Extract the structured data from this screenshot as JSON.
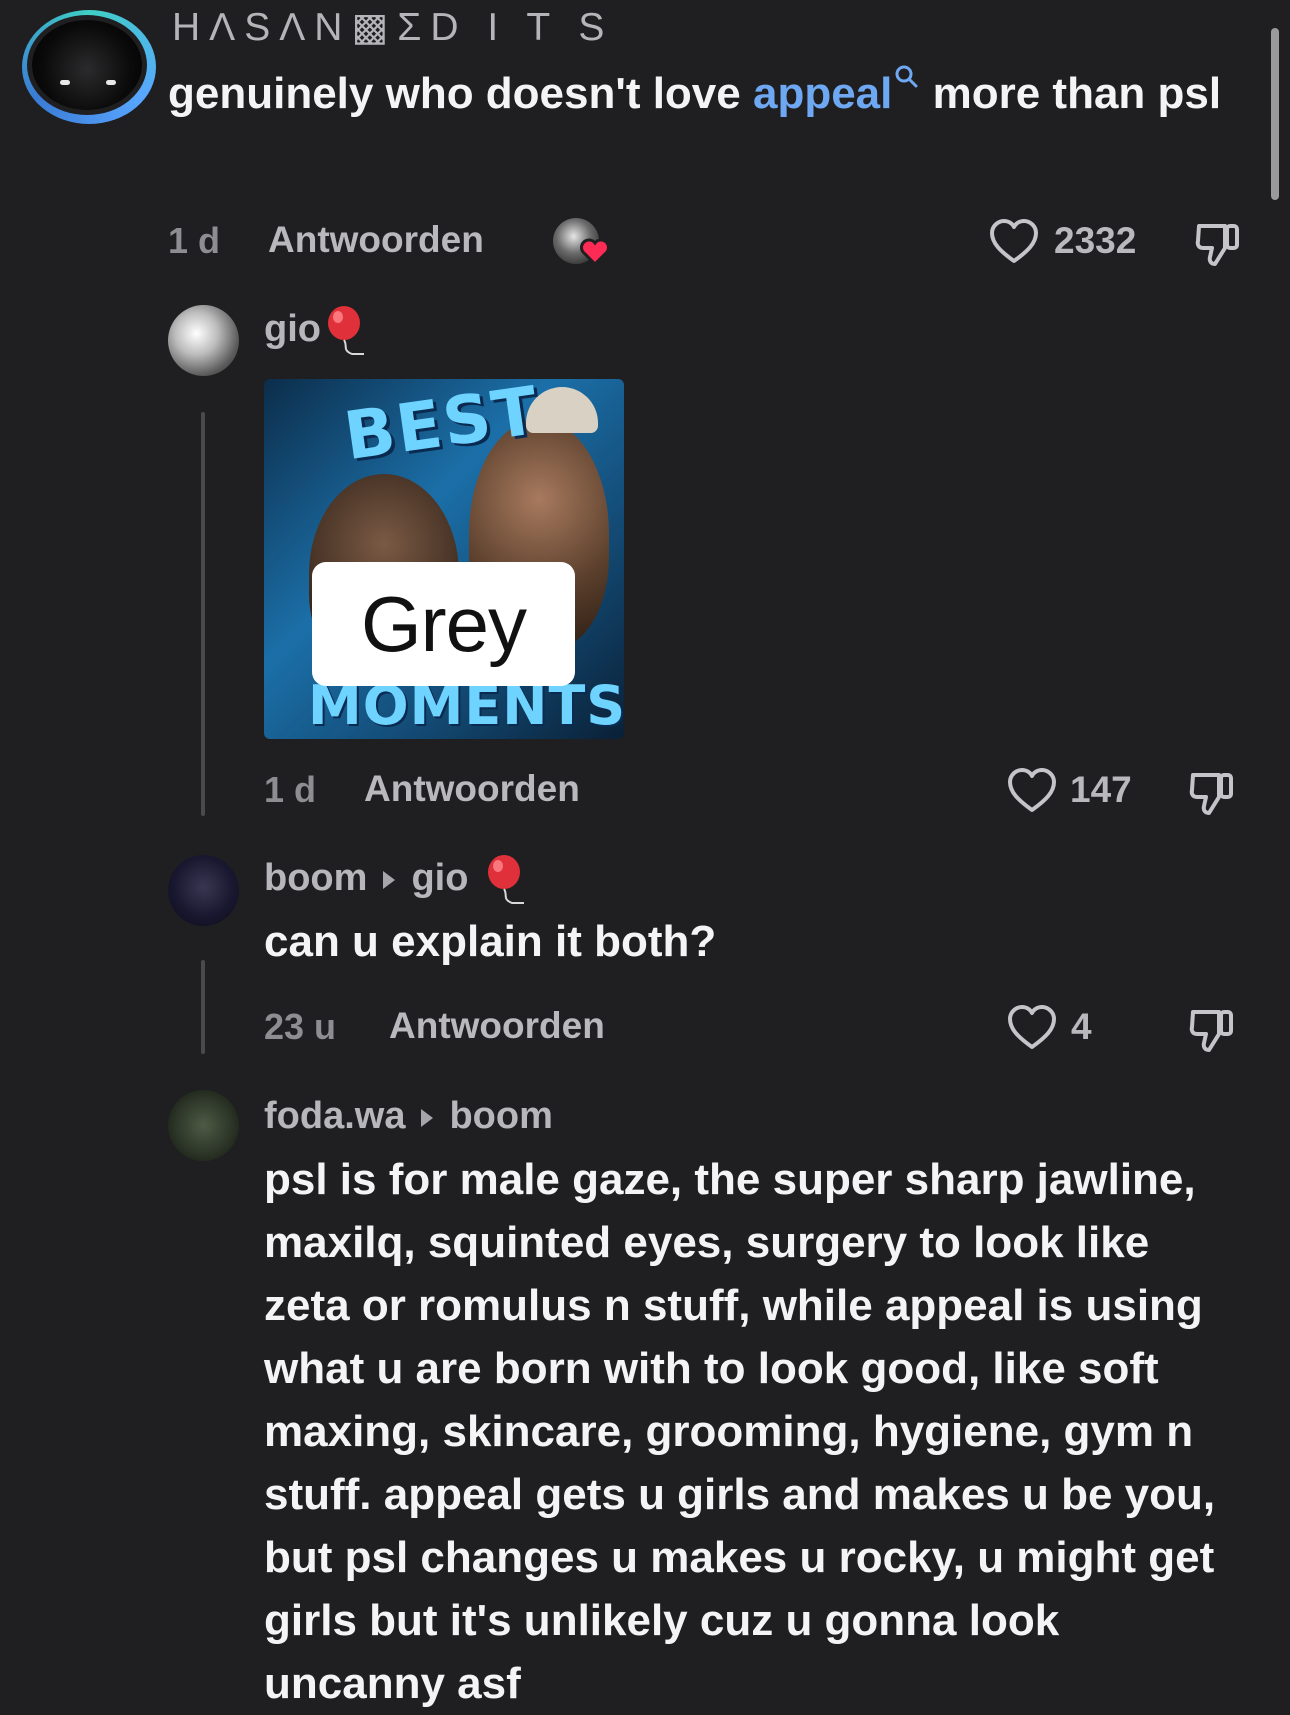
{
  "main_comment": {
    "channel": "HΛSΛN▩ΣD I T S",
    "text_before": "genuinely who doesn't love ",
    "link": "appeal",
    "text_after": " more than psl",
    "time": "1 d",
    "reply": "Antwoorden",
    "likes": "2332"
  },
  "reply_gio": {
    "username": "gio",
    "thumbnail": {
      "label": "Grey",
      "top_text": "BEST",
      "bottom_text": "MOMENTS"
    },
    "time": "1 d",
    "reply": "Antwoorden",
    "likes": "147"
  },
  "reply_boom": {
    "username": "boom",
    "reply_to": "gio",
    "text": "can u explain it both?",
    "time": "23 u",
    "reply": "Antwoorden",
    "likes": "4"
  },
  "reply_foda": {
    "username": "foda.wa",
    "reply_to": "boom",
    "lines": [
      "psl is for male gaze, the super sharp jawline,",
      "maxilq, squinted eyes, surgery to look like",
      "zeta or romulus n stuff, while appeal is using",
      "what u are born with to look good, like soft",
      "maxing, skincare, grooming, hygiene, gym n",
      "stuff. appeal gets u girls and makes u be you,",
      "but psl changes u makes u rocky, u might get",
      "girls but it's unlikely cuz u gonna look",
      "uncanny asf"
    ]
  },
  "icons": {
    "heart": "heart-outline-icon",
    "dislike": "thumbs-down-icon",
    "search": "search-icon",
    "balloon": "balloon-emoji-icon",
    "creator_like": "creator-heart-icon"
  },
  "colors": {
    "background": "#1f1f21",
    "link": "#6fa8f2",
    "muted": "#8d8d92"
  }
}
